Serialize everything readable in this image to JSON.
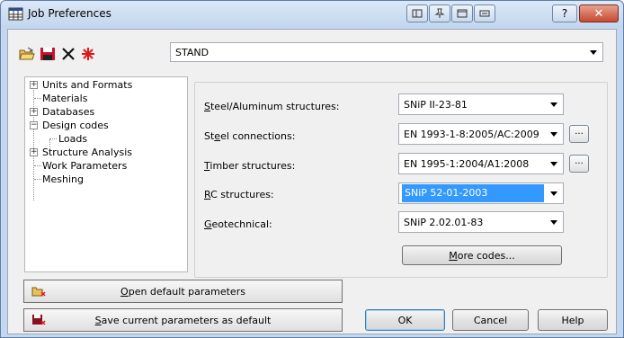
{
  "window": {
    "title": "Job Preferences",
    "buttons": [
      "restore-down-icon",
      "pin-icon",
      "window-icon",
      "minimize-icon",
      "help",
      "close"
    ],
    "help_label": "?",
    "close_label": "✕"
  },
  "toolbar": {
    "icons": [
      "open-folder-icon",
      "save-disk-icon",
      "delete-x-icon",
      "new-star-icon"
    ]
  },
  "preset": {
    "value": "STAND"
  },
  "tree": {
    "items": [
      {
        "label": "Units and Formats",
        "expandable": true,
        "expanded": false
      },
      {
        "label": "Materials",
        "expandable": false
      },
      {
        "label": "Databases",
        "expandable": true,
        "expanded": false
      },
      {
        "label": "Design codes",
        "expandable": true,
        "expanded": true
      },
      {
        "label": "Loads",
        "expandable": false,
        "child": true
      },
      {
        "label": "Structure Analysis",
        "expandable": true,
        "expanded": false
      },
      {
        "label": "Work Parameters",
        "expandable": false
      },
      {
        "label": "Meshing",
        "expandable": false
      }
    ]
  },
  "codes": {
    "steel": {
      "label_pre": "",
      "label_key": "S",
      "label_post": "teel/Aluminum structures:",
      "value": "SNiP II-23-81"
    },
    "connections": {
      "label_pre": "St",
      "label_key": "e",
      "label_post": "el connections:",
      "value": "EN 1993-1-8:2005/AC:2009",
      "more": "..."
    },
    "timber": {
      "label_pre": "",
      "label_key": "T",
      "label_post": "imber structures:",
      "value": "EN 1995-1:2004/A1:2008",
      "more": "..."
    },
    "rc": {
      "label_pre": "",
      "label_key": "R",
      "label_post": "C structures:",
      "value": "SNiP 52-01-2003"
    },
    "geo": {
      "label_pre": "",
      "label_key": "G",
      "label_post": "eotechnical:",
      "value": "SNiP 2.02.01-83"
    },
    "more_codes_pre": "",
    "more_codes_key": "M",
    "more_codes_post": "ore codes..."
  },
  "bottom": {
    "open_default_pre": "",
    "open_default_key": "O",
    "open_default_post": "pen default parameters",
    "save_default_pre": "",
    "save_default_key": "S",
    "save_default_post": "ave current parameters as default",
    "ok": "OK",
    "cancel": "Cancel",
    "help": "Help"
  },
  "colors": {
    "selection": "#3399ff",
    "title_bg": "#c4d7ee",
    "close_red": "#c74a32"
  }
}
